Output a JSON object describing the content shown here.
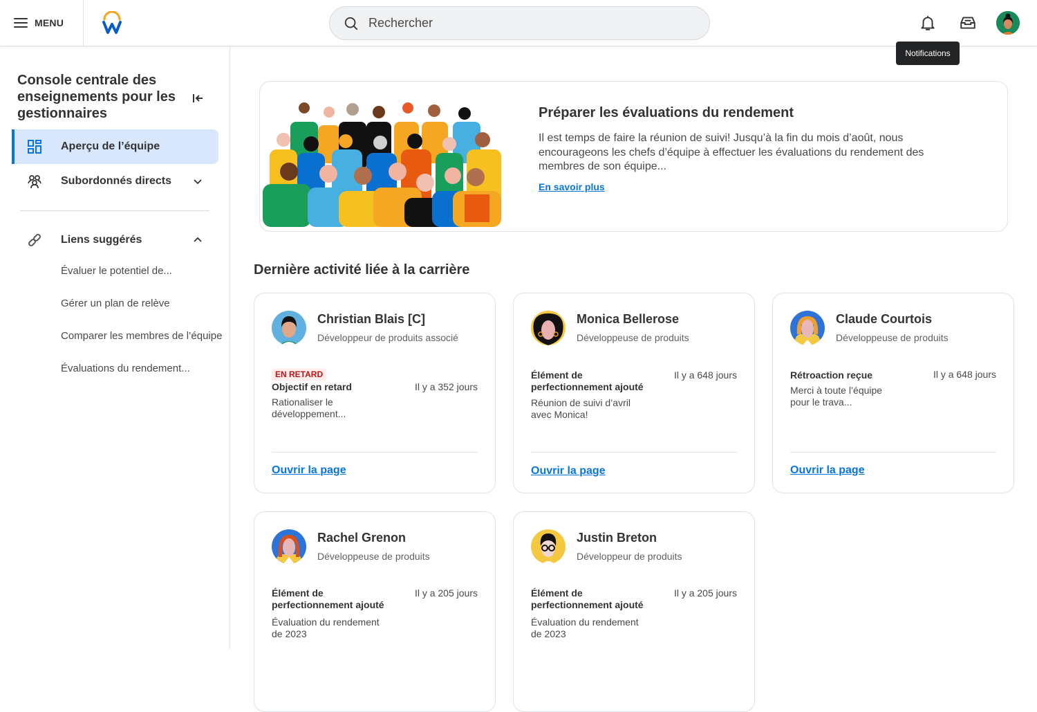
{
  "header": {
    "menu_label": "MENU",
    "search_placeholder": "Rechercher",
    "tooltip": "Notifications",
    "icons": [
      "menu-icon",
      "workday-logo",
      "search-icon",
      "bell-icon",
      "inbox-icon",
      "avatar"
    ]
  },
  "sidebar": {
    "title": "Console centrale des enseignements pour les gestionnaires",
    "items": [
      {
        "label": "Aperçu de l’équipe",
        "icon": "dashboard-icon",
        "active": true
      },
      {
        "label": "Subordonnés directs",
        "icon": "team-icon",
        "expanded": false
      }
    ],
    "suggested": {
      "label": "Liens suggérés",
      "icon": "link-icon",
      "expanded": true,
      "links": [
        "Évaluer le potentiel de...",
        "Gérer un plan de relève",
        "Comparer les membres de l’équipe",
        "Évaluations du rendement..."
      ]
    }
  },
  "banner": {
    "title": "Préparer les évaluations du rendement",
    "text": "Il est temps de faire la réunion de suivi! Jusqu’à la fin du mois d’août, nous encourageons les chefs d’équipe à effectuer les évaluations du rendement des membres de son équipe...",
    "link": "En savoir plus"
  },
  "activity": {
    "title": "Dernière activité liée à la carrière",
    "open_label": "Ouvrir la page",
    "cards": [
      {
        "name": "Christian Blais [C]",
        "role": "Développeur de produits associé",
        "badge": "EN RETARD",
        "activity": "Objectif en retard",
        "desc": "Rationaliser le développement...",
        "when": "Il y a 352 jours"
      },
      {
        "name": "Monica Bellerose",
        "role": "Développeuse de produits",
        "badge": "",
        "activity": "Élément de perfectionnement ajouté",
        "desc": "Réunion de suivi d’avril avec Monica!",
        "when": "Il y a 648 jours"
      },
      {
        "name": "Claude Courtois",
        "role": "Développeuse de produits",
        "badge": "",
        "activity": "Rétroaction reçue",
        "desc": "Merci à toute l’équipe pour le trava...",
        "when": "Il y a 648 jours"
      },
      {
        "name": "Rachel Grenon",
        "role": "Développeuse de produits",
        "badge": "",
        "activity": "Élément de perfectionnement ajouté",
        "desc": "Évaluation du rendement de 2023",
        "when": "Il y a 205 jours"
      },
      {
        "name": "Justin Breton",
        "role": "Développeur de produits",
        "badge": "",
        "activity": "Élément de perfectionnement ajouté",
        "desc": "Évaluation du rendement de 2023",
        "when": "Il y a 205 jours"
      }
    ]
  },
  "colors": {
    "accent": "#0875e1",
    "active_bg": "#d8e7fb",
    "late_text": "#b81616",
    "late_bg": "#fdecec",
    "logo_orange": "#f5a623"
  }
}
